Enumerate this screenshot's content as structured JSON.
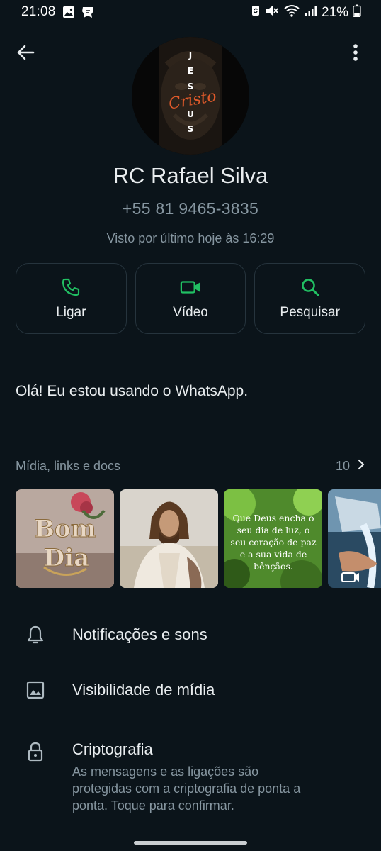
{
  "status_bar": {
    "time": "21:08",
    "battery": "21%",
    "icons": [
      "image-icon",
      "app-notification-icon",
      "sync-icon",
      "mute-icon",
      "wifi-icon",
      "signal-icon",
      "battery-icon"
    ]
  },
  "header": {
    "back_icon": "back-arrow-icon",
    "menu_icon": "more-vert-icon"
  },
  "avatar": {
    "letters": [
      "J",
      "E",
      "S",
      "U",
      "S"
    ],
    "script_text": "Cristo"
  },
  "contact": {
    "name": "RC Rafael Silva",
    "phone": "+55 81 9465-3835",
    "last_seen": "Visto por último hoje às 16:29"
  },
  "actions": [
    {
      "label": "Ligar",
      "icon": "phone-icon"
    },
    {
      "label": "Vídeo",
      "icon": "video-icon"
    },
    {
      "label": "Pesquisar",
      "icon": "search-icon"
    }
  ],
  "about": "Olá! Eu estou usando o WhatsApp.",
  "media": {
    "title": "Mídia, links e docs",
    "count": "10",
    "thumb1_text": [
      "Bom",
      "Dia"
    ],
    "thumb3_text": [
      "Que Deus encha o",
      "seu dia de luz, o",
      "seu coração de paz",
      "e a sua vida de",
      "bênçãos."
    ]
  },
  "settings": [
    {
      "title": "Notificações e sons",
      "icon": "bell-icon"
    },
    {
      "title": "Visibilidade de mídia",
      "icon": "image-icon"
    },
    {
      "title": "Criptografia",
      "icon": "lock-icon",
      "subtitle_lines": [
        "As mensagens e as ligações são",
        "protegidas com a criptografia de ponta a",
        "ponta. Toque para confirmar."
      ]
    }
  ],
  "colors": {
    "background": "#0b141a",
    "accent_green": "#21c063",
    "secondary_text": "#8696a0",
    "primary_text": "#e9edef"
  }
}
